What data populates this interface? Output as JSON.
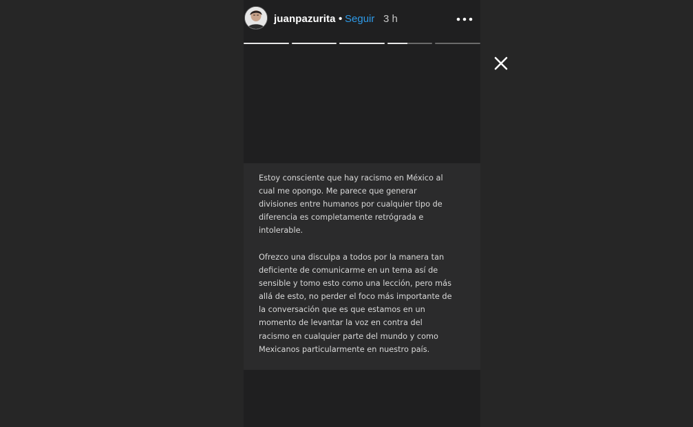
{
  "story": {
    "username": "juanpazurita",
    "separator": "•",
    "follow_label": "Seguir",
    "time_ago": "3 h",
    "progress": [
      1,
      1,
      1,
      0.45,
      0
    ],
    "paragraphs": [
      "Estoy consciente que hay racismo en México al\ncual me opongo. Me parece que generar\ndivisiones entre humanos por cualquier tipo de\ndiferencia es completamente retrógrada e\nintolerable.",
      "Ofrezco una disculpa a todos por la manera tan\ndeficiente de comunicarme en un tema así de\nsensible y tomo esto como una lección, pero más\nallá de esto, no perder el foco más importante de\nla conversación que es que estamos en un\nmomento de levantar la voz en contra del\nracismo en cualquier parte del mundo y como\nMexicanos particularmente en nuestro país."
    ]
  },
  "icons": {
    "more": "more-options-icon",
    "close": "close-icon",
    "avatar": "avatar"
  },
  "colors": {
    "background": "#262626",
    "story_bg": "#1f1f20",
    "text_card": "#2b2b2c",
    "follow": "#2e9ae8",
    "text": "#d9d9d9"
  }
}
